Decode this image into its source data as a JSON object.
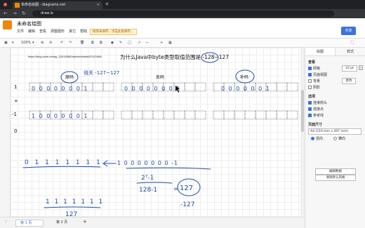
{
  "browser": {
    "tab_title": "未命名绘图 - diagrams.net",
    "url": "draw.io"
  },
  "app": {
    "title": "未命名绘图",
    "menu": [
      "文件",
      "编辑",
      "查看",
      "调整图形",
      "其它",
      "帮助"
    ],
    "unsaved_notice": "修改未保存，点击此处保存。",
    "share_label": "共享",
    "zoom": "100%"
  },
  "canvas": {
    "link_text": "https://blog.csdn.net/qq_23418360/article/details/57421666",
    "heading": "为什么Java中byte类型取值范围是 -128~127",
    "col_labels": [
      "原码",
      "反码",
      "补码"
    ],
    "row_labels": [
      "1",
      "+",
      "-1",
      "0"
    ],
    "hand": {
      "orig_note": "倍关 -127~127",
      "orig_row1": "0 0 0 0 0 0 0 1",
      "orig_row2": "1 0 0 0 0 0 0 1",
      "inv_row1": "0 0 0 0 0 0 0 1",
      "comp_row1": "0 0 0 0 0 0 1",
      "big_binary": "0 1 1 1 1 1 1 1",
      "arrow_binary": "1 0 0 0 0 0 0 0 -1",
      "pow": "2⁷-1",
      "calc": "128-1",
      "result": "127",
      "neg": "-127",
      "seven_ones": "1 1 1 1 1 1 1",
      "under": "127"
    }
  },
  "panel": {
    "tabs": [
      "绘图",
      "样式"
    ],
    "view_section": "查看",
    "grid_label": "网格",
    "grid_size": "10 pt",
    "page_view_label": "页面视图",
    "background_label": "背景",
    "shadow_label": "阴影",
    "change_label": "更改",
    "options_section": "选项",
    "connection_arrows": "连接箭头",
    "connection_points": "连接点",
    "guides": "参考线",
    "paper_size_section": "页面尺寸",
    "paper_size": "A4 (210 mm x 297 mm)",
    "portrait": "竖向",
    "landscape": "横向",
    "edit_data": "编辑数据",
    "clear_default": "清除默认风格"
  },
  "pages": [
    "第 1 页",
    "第 2 页"
  ]
}
